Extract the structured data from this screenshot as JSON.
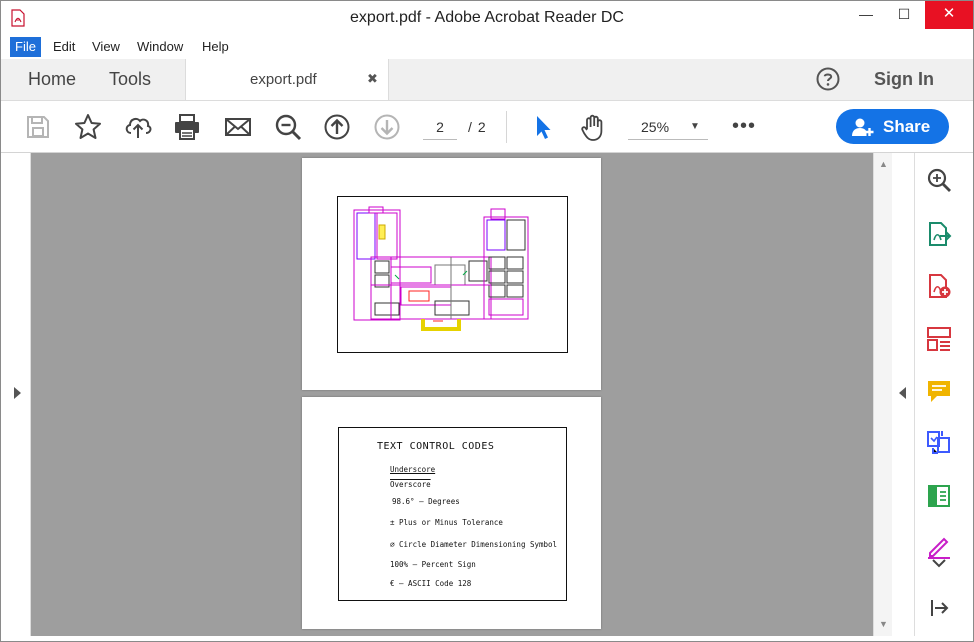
{
  "window": {
    "title": "export.pdf - Adobe Acrobat Reader DC",
    "minimize": "—",
    "maximize": "☐",
    "close": "✕"
  },
  "menu": [
    "File",
    "Edit",
    "View",
    "Window",
    "Help"
  ],
  "tabs": {
    "home": "Home",
    "tools": "Tools",
    "document": "export.pdf",
    "close": "✖"
  },
  "header": {
    "help_icon": "question-circle-icon",
    "sign_in": "Sign In"
  },
  "toolbar": {
    "icons": [
      "save-icon",
      "star-icon",
      "cloud-upload-icon",
      "print-icon",
      "email-icon",
      "zoom-out-icon",
      "page-up-icon",
      "page-down-icon",
      "select-cursor-icon",
      "hand-tool-icon"
    ],
    "current_page": "2",
    "page_separator": "/",
    "total_pages": "2",
    "zoom": "25%",
    "more": "•••",
    "share": "Share"
  },
  "colors": {
    "accent": "#1473e6",
    "close_button": "#e81123",
    "canvas": "#9e9e9e"
  },
  "document": {
    "page2_title": "TEXT CONTROL CODES",
    "page2_lines": [
      "Underscore",
      "Overscore",
      "98.6° — Degrees",
      "± Plus or Minus Tolerance",
      "⌀ Circle Diameter Dimensioning Symbol",
      "100% — Percent Sign",
      "€ — ASCII Code 128"
    ]
  },
  "right_tools": [
    "enhance-scans-icon",
    "export-pdf-icon",
    "create-pdf-icon",
    "organize-pages-icon",
    "comment-icon",
    "combine-files-icon",
    "edit-pdf-icon",
    "fill-sign-icon",
    "expand-tools-icon",
    "collapse-panel-icon"
  ]
}
